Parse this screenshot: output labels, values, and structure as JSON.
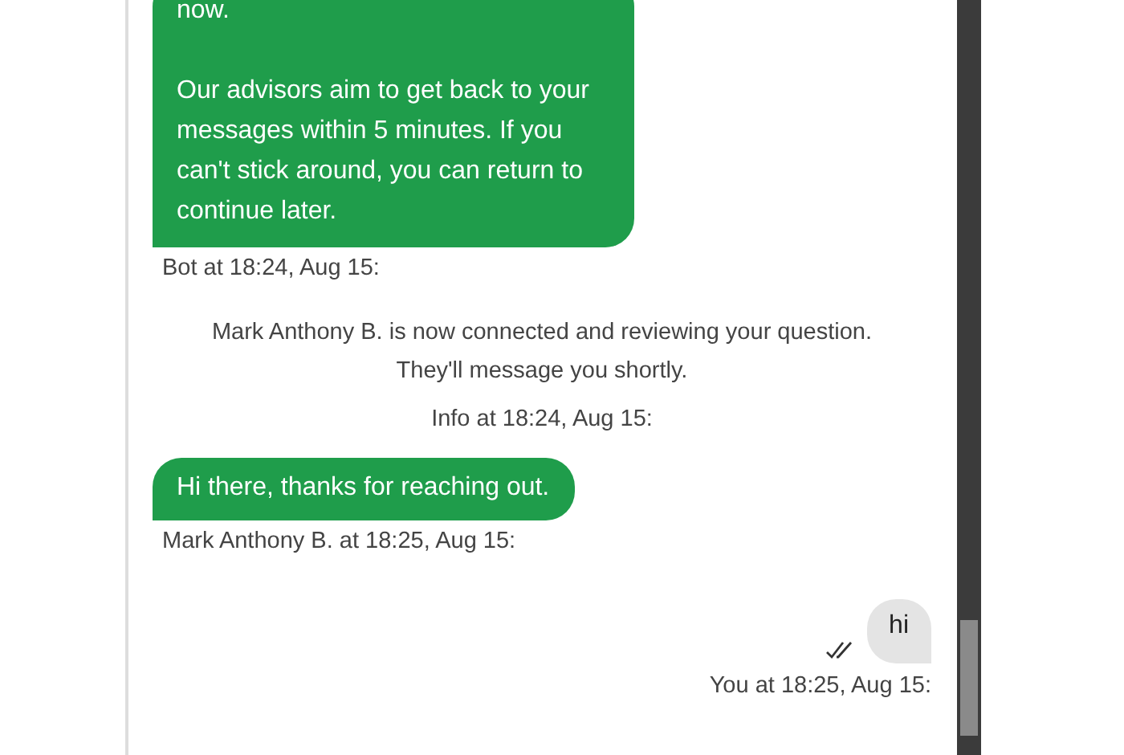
{
  "messages": [
    {
      "kind": "agent",
      "paragraphs": [
        "now.",
        "Our advisors aim to get back to your messages within 5 minutes. If you can't stick around, you can return to continue later."
      ],
      "meta": "Bot at 18:24, Aug 15:"
    },
    {
      "kind": "info",
      "paragraphs": [
        "Mark Anthony B. is now connected and reviewing your question. They'll message you shortly."
      ],
      "meta": "Info at 18:24, Aug 15:"
    },
    {
      "kind": "agent",
      "paragraphs": [
        "Hi there, thanks for reaching out."
      ],
      "meta": "Mark Anthony B. at 18:25, Aug 15:"
    },
    {
      "kind": "user",
      "paragraphs": [
        "hi"
      ],
      "meta": "You at 18:25, Aug 15:",
      "read": true
    }
  ]
}
